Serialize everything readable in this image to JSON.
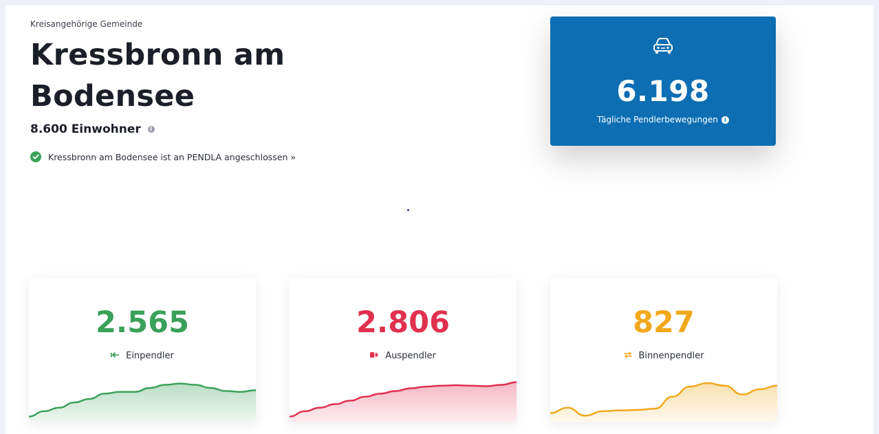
{
  "header": {
    "eyebrow": "Kreisangehörige Gemeinde",
    "title": "Kressbronn am Bodensee",
    "population_value": "8.600 Einwohner",
    "connected_text": "Kressbronn am Bodensee ist an PENDLA angeschlossen »"
  },
  "hero": {
    "icon": "car-icon",
    "value": "6.198",
    "label": "Tägliche Pendlerbewegungen"
  },
  "stats": [
    {
      "value": "2.565",
      "label": "Einpendler",
      "icon": "arrow-in-icon",
      "color": "#3aa15a",
      "sparkline": [
        0.1,
        0.22,
        0.3,
        0.42,
        0.5,
        0.62,
        0.66,
        0.66,
        0.75,
        0.82,
        0.85,
        0.82,
        0.75,
        0.68,
        0.66,
        0.7
      ]
    },
    {
      "value": "2.806",
      "label": "Auspendler",
      "icon": "arrow-out-icon",
      "color": "#e0304f",
      "sparkline": [
        0.1,
        0.22,
        0.3,
        0.38,
        0.46,
        0.55,
        0.62,
        0.68,
        0.74,
        0.78,
        0.8,
        0.81,
        0.8,
        0.79,
        0.82,
        0.88
      ]
    },
    {
      "value": "827",
      "label": "Binnenpendler",
      "icon": "swap-icon",
      "color": "#f2a81d",
      "sparkline": [
        0.18,
        0.3,
        0.12,
        0.22,
        0.24,
        0.25,
        0.28,
        0.55,
        0.78,
        0.86,
        0.8,
        0.6,
        0.72,
        0.8
      ]
    }
  ]
}
